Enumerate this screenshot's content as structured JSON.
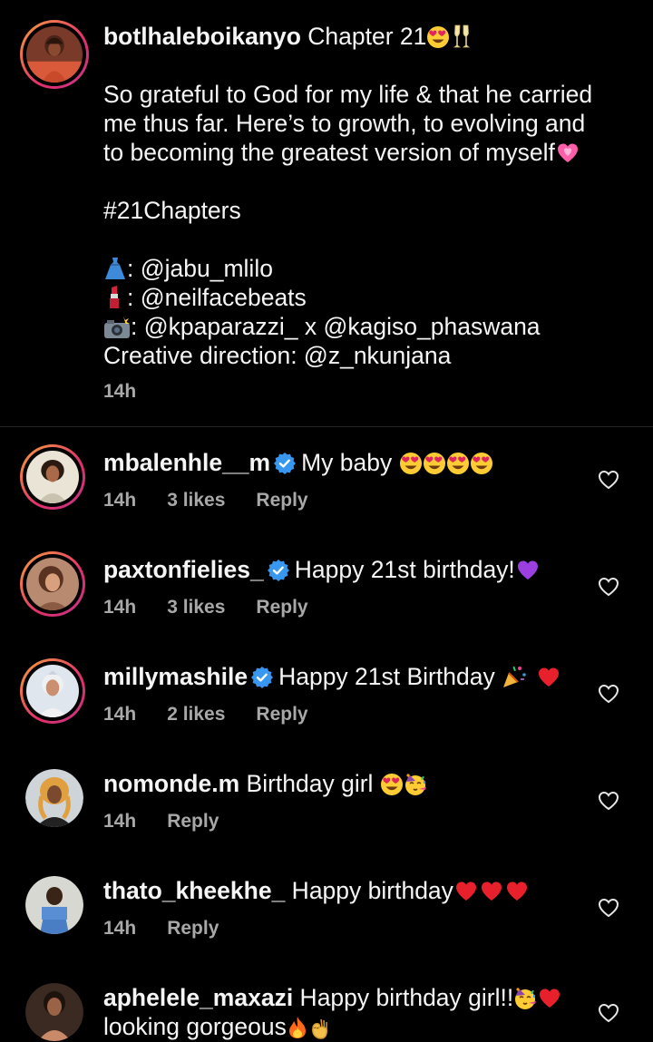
{
  "post": {
    "username": "botlhaleboikanyo",
    "first_line_text": " Chapter 21",
    "line_2": "So grateful to God for my life & that he carried",
    "line_3": "me thus far. Here’s to growth, to evolving and",
    "line_4": "to becoming the greatest version of myself",
    "hashtag": "#21Chapters",
    "credit_1": ": @jabu_mlilo",
    "credit_2": ": @neilfacebeats",
    "credit_3": ": @kpaparazzi_ x @kagiso_phaswana",
    "credit_4": "Creative direction: @z_nkunjana",
    "time": "14h"
  },
  "comments": [
    {
      "username": "mbalenhle__m",
      "text": "My baby ",
      "time": "14h",
      "likes": "3 likes",
      "reply": "Reply"
    },
    {
      "username": "paxtonfielies_",
      "text": "Happy 21st birthday!",
      "time": "14h",
      "likes": "3 likes",
      "reply": "Reply"
    },
    {
      "username": "millymashile",
      "text": "Happy 21st Birthday ",
      "time": "14h",
      "likes": "2 likes",
      "reply": "Reply"
    },
    {
      "username": "nomonde.m",
      "text": " Birthday girl ",
      "time": "14h",
      "reply": "Reply"
    },
    {
      "username": "thato_kheekhe_",
      "text": " Happy birthday",
      "time": "14h",
      "reply": "Reply"
    },
    {
      "username": "aphelele_maxazi",
      "text": " Happy birthday girl!!",
      "text_line_2": "looking gorgeous"
    }
  ],
  "colors": {
    "background": "#000000",
    "text": "#f5f5f5",
    "secondary": "#a8a8a8",
    "verified": "#3897f0",
    "divider": "#262626"
  },
  "icons": [
    "heart-eyes-emoji",
    "champagne-emoji",
    "pink-heart-emoji",
    "dress-emoji",
    "lipstick-emoji",
    "camera-flash-emoji",
    "verified-badge-icon",
    "purple-heart-emoji",
    "party-popper-emoji",
    "red-heart-emoji",
    "partying-face-emoji",
    "fire-emoji",
    "ok-hand-emoji",
    "like-heart-icon"
  ]
}
